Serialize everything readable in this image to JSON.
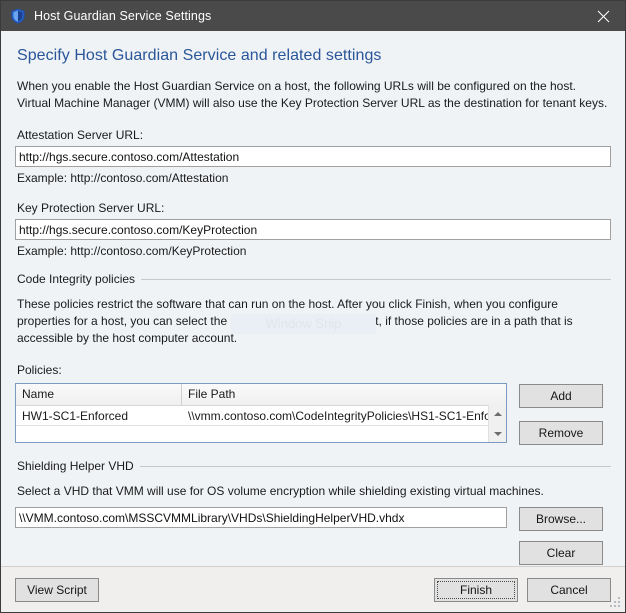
{
  "titlebar": {
    "title": "Host Guardian Service Settings",
    "icon": "shield-icon",
    "close_label": "✕"
  },
  "page": {
    "heading": "Specify Host Guardian Service and related settings",
    "intro_line1": "When you enable the Host Guardian Service on a host, the following URLs will be configured on the host.",
    "intro_line2": "Virtual Machine Manager (VMM) will also use the Key Protection Server URL as the destination for tenant keys."
  },
  "attestation": {
    "label": "Attestation Server URL:",
    "value": "http://hgs.secure.contoso.com/Attestation",
    "example": "Example: http://contoso.com/Attestation"
  },
  "key_protection": {
    "label": "Key Protection Server URL:",
    "value": "http://hgs.secure.contoso.com/KeyProtection",
    "example": "Example: http://contoso.com/KeyProtection"
  },
  "code_integrity": {
    "group_label": "Code Integrity policies",
    "description_line1": "These policies restrict the software that can run on the host. After you click Finish, when you configure",
    "description_line2": "properties for a host, you can select the policies to apply to that host, if those policies are in a path that is",
    "description_line3": "accessible by the host computer account.",
    "policies_label": "Policies:",
    "columns": [
      "Name",
      "File Path"
    ],
    "rows": [
      {
        "name": "HW1-SC1-Enforced",
        "file_path": "\\\\vmm.contoso.com\\CodeIntegrityPolicies\\HS1-SC1-Enfo..."
      }
    ],
    "add_label": "Add",
    "remove_label": "Remove"
  },
  "shielding_helper": {
    "group_label": "Shielding Helper VHD",
    "description": "Select a VHD that VMM will use for OS volume encryption while shielding existing virtual machines.",
    "value": "\\\\VMM.contoso.com\\MSSCVMMLibrary\\VHDs\\ShieldingHelperVHD.vhdx",
    "browse_label": "Browse...",
    "clear_label": "Clear"
  },
  "footer": {
    "view_script_label": "View Script",
    "finish_label": "Finish",
    "cancel_label": "Cancel"
  },
  "watermark": {
    "text": "Window Snip"
  },
  "colors": {
    "titlebar_bg": "#4a4a4a",
    "heading": "#2a5699",
    "content_bg": "#f0f3f6",
    "footer_bg": "#f0efee",
    "list_border": "#7a9bbd"
  }
}
